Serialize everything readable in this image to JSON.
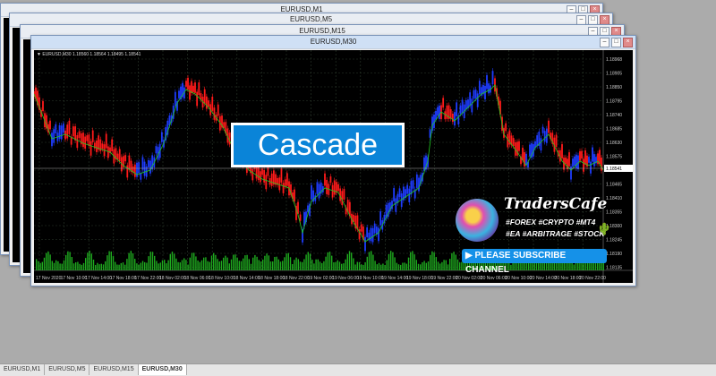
{
  "windows": [
    {
      "title": "EURUSD,M1"
    },
    {
      "title": "EURUSD,M5"
    },
    {
      "title": "EURUSD,M15"
    },
    {
      "title": "EURUSD,M30"
    }
  ],
  "window_controls": {
    "minimize": "–",
    "restore": "□",
    "close": "×"
  },
  "chart": {
    "symbol_info": "▼ EURUSD,M30  1.18560 1.18564 1.18495 1.18541",
    "price_levels": [
      "1.18968",
      "1.18905",
      "1.18850",
      "1.18795",
      "1.18740",
      "1.18685",
      "1.18630",
      "1.18575",
      "1.18520",
      "1.18465",
      "1.18410",
      "1.18355",
      "1.18300",
      "1.18245",
      "1.18190",
      "1.18135"
    ],
    "current_price": "1.18541",
    "time_labels": [
      "17 Nov 2020",
      "17 Nov 10:00",
      "17 Nov 14:00",
      "17 Nov 18:00",
      "17 Nov 22:00",
      "18 Nov 02:00",
      "18 Nov 06:00",
      "18 Nov 10:00",
      "18 Nov 14:00",
      "18 Nov 18:00",
      "18 Nov 22:00",
      "19 Nov 02:00",
      "19 Nov 06:00",
      "19 Nov 10:00",
      "19 Nov 14:00",
      "19 Nov 18:00",
      "19 Nov 22:00",
      "20 Nov 02:00",
      "20 Nov 06:00",
      "20 Nov 10:00",
      "20 Nov 14:00",
      "20 Nov 18:00",
      "20 Nov 22:00"
    ],
    "colors": {
      "background": "#000000",
      "bull": "#1e3cff",
      "bear": "#ff1a1a",
      "volume": "#1faa1f"
    }
  },
  "overlay": {
    "cascade_label": "Cascade"
  },
  "promo": {
    "brand": "TradersCafe",
    "tags_line1": "#FOREX #CRYPTO #MT4",
    "tags_line2": "#EA #ARBITRAGE #STOCK",
    "subscribe_label": "▶ PLEASE SUBSCRIBE CHANNEL"
  },
  "tabs": [
    {
      "label": "EURUSD,M1",
      "active": false
    },
    {
      "label": "EURUSD,M5",
      "active": false
    },
    {
      "label": "EURUSD,M15",
      "active": false
    },
    {
      "label": "EURUSD,M30",
      "active": true
    }
  ]
}
